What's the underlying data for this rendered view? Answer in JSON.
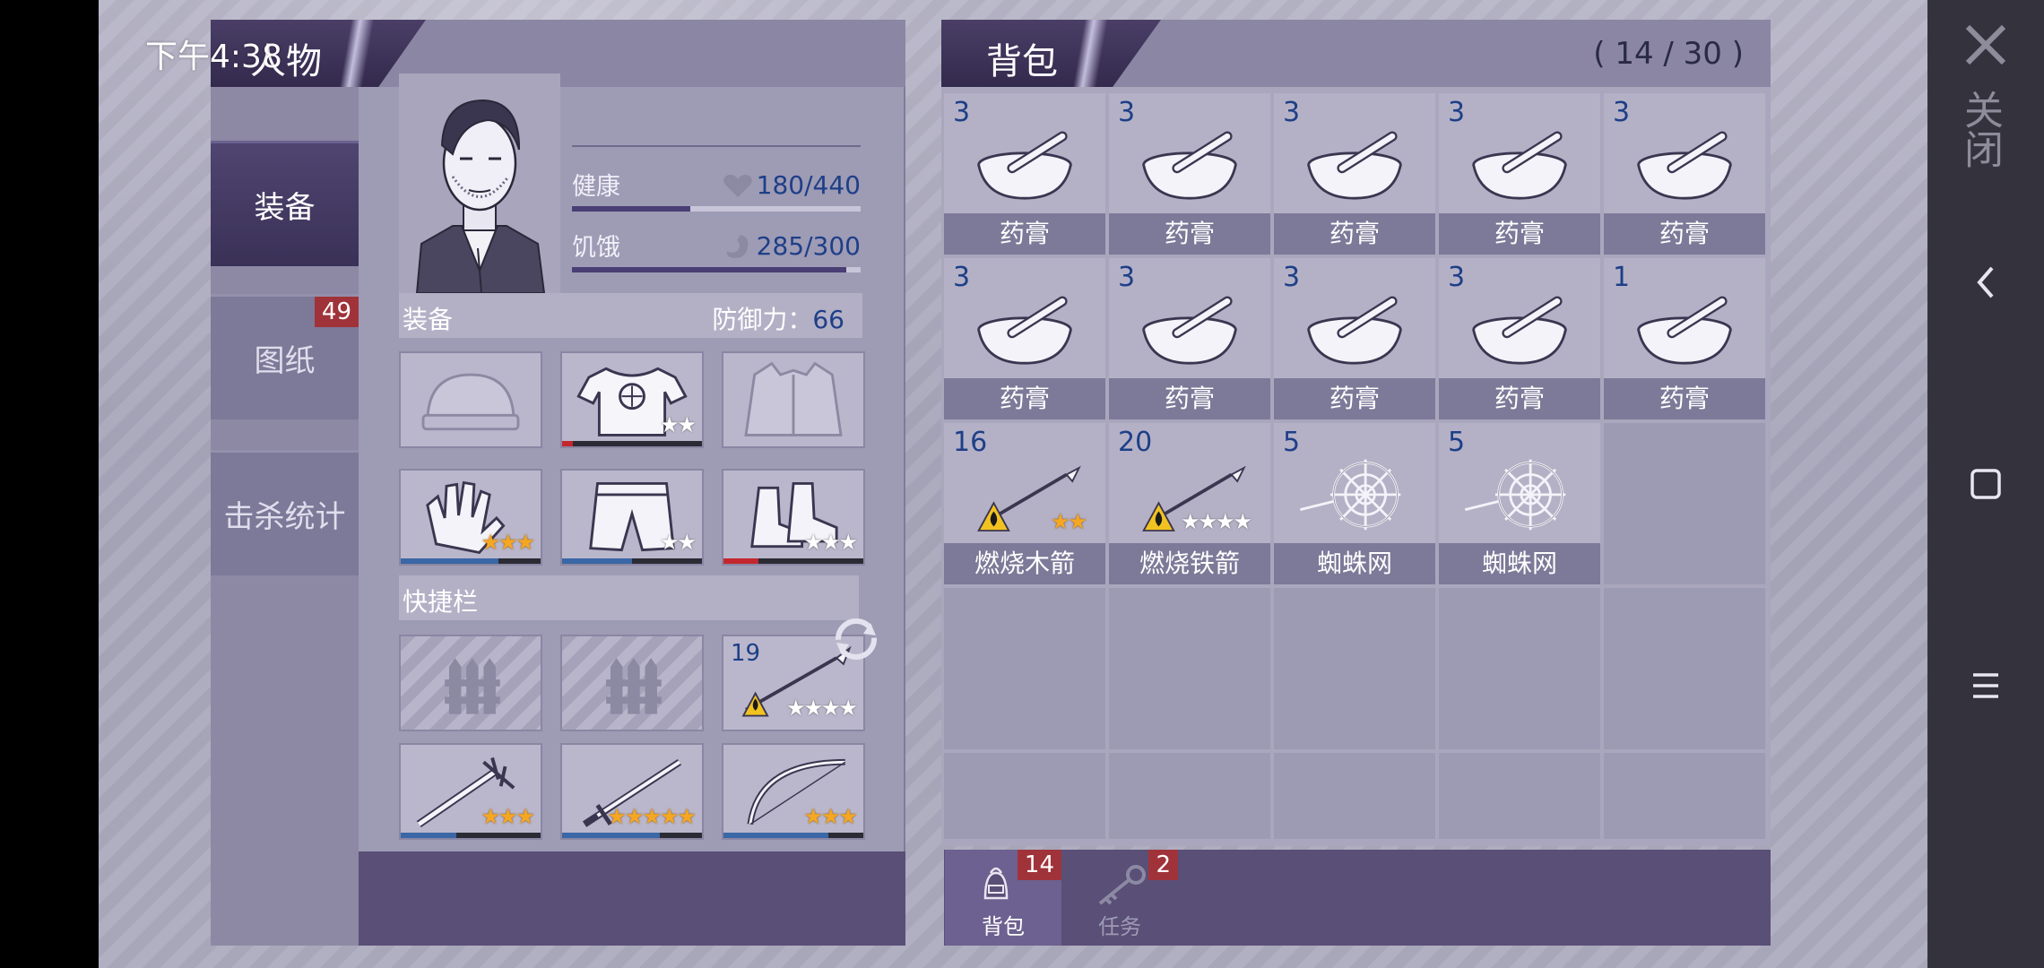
{
  "status": {
    "time": "下午4:38"
  },
  "tabs": {
    "character": "人物",
    "equipment": "装备",
    "blueprints": "图纸",
    "blueprints_badge": "49",
    "kills": "击杀统计"
  },
  "stats": {
    "health_label": "健康",
    "health_value": "180/440",
    "health_fraction": 0.41,
    "hunger_label": "饥饿",
    "hunger_value": "285/300",
    "hunger_fraction": 0.95
  },
  "equipment_section": {
    "title": "装备",
    "defense_label": "防御力：",
    "defense_value": "66"
  },
  "equipment_slots": [
    {
      "icon": "beanie-icon",
      "stars": 0,
      "empty": true
    },
    {
      "icon": "tshirt-icon",
      "stars": 2,
      "gold": 0,
      "durability": 0.08,
      "dur_color": "#c4262e"
    },
    {
      "icon": "jacket-icon",
      "stars": 0,
      "empty": true
    },
    {
      "icon": "gloves-icon",
      "stars": 3,
      "gold": 3,
      "durability": 0.7,
      "dur_color": "#3a67a5"
    },
    {
      "icon": "shorts-icon",
      "stars": 2,
      "gold": 0,
      "durability": 0.5,
      "dur_color": "#3a67a5"
    },
    {
      "icon": "boots-icon",
      "stars": 3,
      "gold": 0,
      "durability": 0.25,
      "dur_color": "#c4262e"
    }
  ],
  "quickbar": {
    "title": "快捷栏",
    "slots": [
      {
        "icon": "locked-fence-icon",
        "hatch": true
      },
      {
        "icon": "locked-fence-icon",
        "hatch": true
      },
      {
        "icon": "burning-spear-icon",
        "count": "19",
        "stars": 4,
        "gold": 0
      },
      {
        "icon": "spiked-club-icon",
        "stars": 3,
        "gold": 3,
        "durability": 0.4,
        "dur_color": "#3a67a5"
      },
      {
        "icon": "sword-icon",
        "stars": 5,
        "gold": 5,
        "durability": 0.7,
        "dur_color": "#3a67a5"
      },
      {
        "icon": "bow-icon",
        "stars": 3,
        "gold": 3,
        "durability": 0.75,
        "dur_color": "#3a67a5"
      }
    ]
  },
  "bag": {
    "title": "背包",
    "capacity": "( 14 / 30 )",
    "items": [
      {
        "name": "药膏",
        "count": "3",
        "icon": "mortar-icon"
      },
      {
        "name": "药膏",
        "count": "3",
        "icon": "mortar-icon"
      },
      {
        "name": "药膏",
        "count": "3",
        "icon": "mortar-icon"
      },
      {
        "name": "药膏",
        "count": "3",
        "icon": "mortar-icon"
      },
      {
        "name": "药膏",
        "count": "3",
        "icon": "mortar-icon"
      },
      {
        "name": "药膏",
        "count": "3",
        "icon": "mortar-icon"
      },
      {
        "name": "药膏",
        "count": "3",
        "icon": "mortar-icon"
      },
      {
        "name": "药膏",
        "count": "3",
        "icon": "mortar-icon"
      },
      {
        "name": "药膏",
        "count": "3",
        "icon": "mortar-icon"
      },
      {
        "name": "药膏",
        "count": "1",
        "icon": "mortar-icon"
      },
      {
        "name": "燃烧木箭",
        "count": "16",
        "icon": "burning-arrow-icon",
        "stars": 2,
        "gold": 2
      },
      {
        "name": "燃烧铁箭",
        "count": "20",
        "icon": "burning-arrow-icon",
        "stars": 4,
        "gold": 0
      },
      {
        "name": "蜘蛛网",
        "count": "5",
        "icon": "spider-web-icon"
      },
      {
        "name": "蜘蛛网",
        "count": "5",
        "icon": "spider-web-icon"
      }
    ],
    "total_slots": 25
  },
  "bottom_tabs": [
    {
      "label": "背包",
      "badge": "14",
      "icon": "backpack-icon",
      "active": true
    },
    {
      "label": "任务",
      "badge": "2",
      "icon": "key-icon",
      "active": false
    }
  ],
  "system": {
    "close_label": "关闭"
  },
  "colors": {
    "accent": "#4a3e66",
    "count_blue": "#1e3f87",
    "badge_red": "#a0333a"
  }
}
